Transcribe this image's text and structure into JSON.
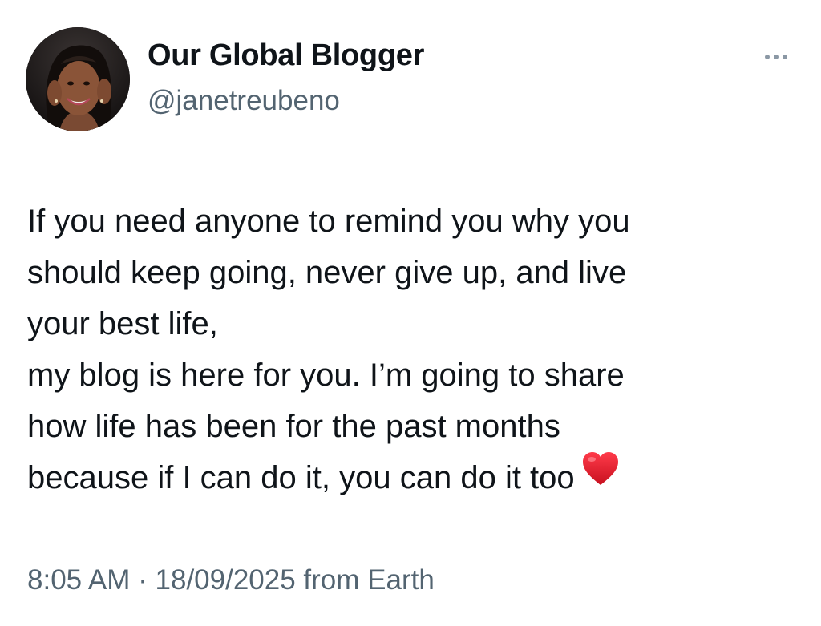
{
  "author": {
    "display_name": "Our Global Blogger",
    "handle": "@janetreubeno",
    "avatar_icon": "profile-photo"
  },
  "menu": {
    "icon": "more-horizontal-icon"
  },
  "tweet": {
    "lines": [
      "If you need anyone to remind you why you",
      "should keep going, never give up, and live",
      "your best life,",
      "my blog is here for you. I’m going to share",
      "how life has been for the past months",
      "because if I can do it, you can do it too"
    ],
    "emoji": "heart-emoji"
  },
  "meta": {
    "time": "8:05 AM",
    "separator": " · ",
    "date": "18/09/2025",
    "source": " from Earth"
  },
  "colors": {
    "text_primary": "#0f1419",
    "text_secondary": "#536471",
    "heart": "#e0162b"
  }
}
